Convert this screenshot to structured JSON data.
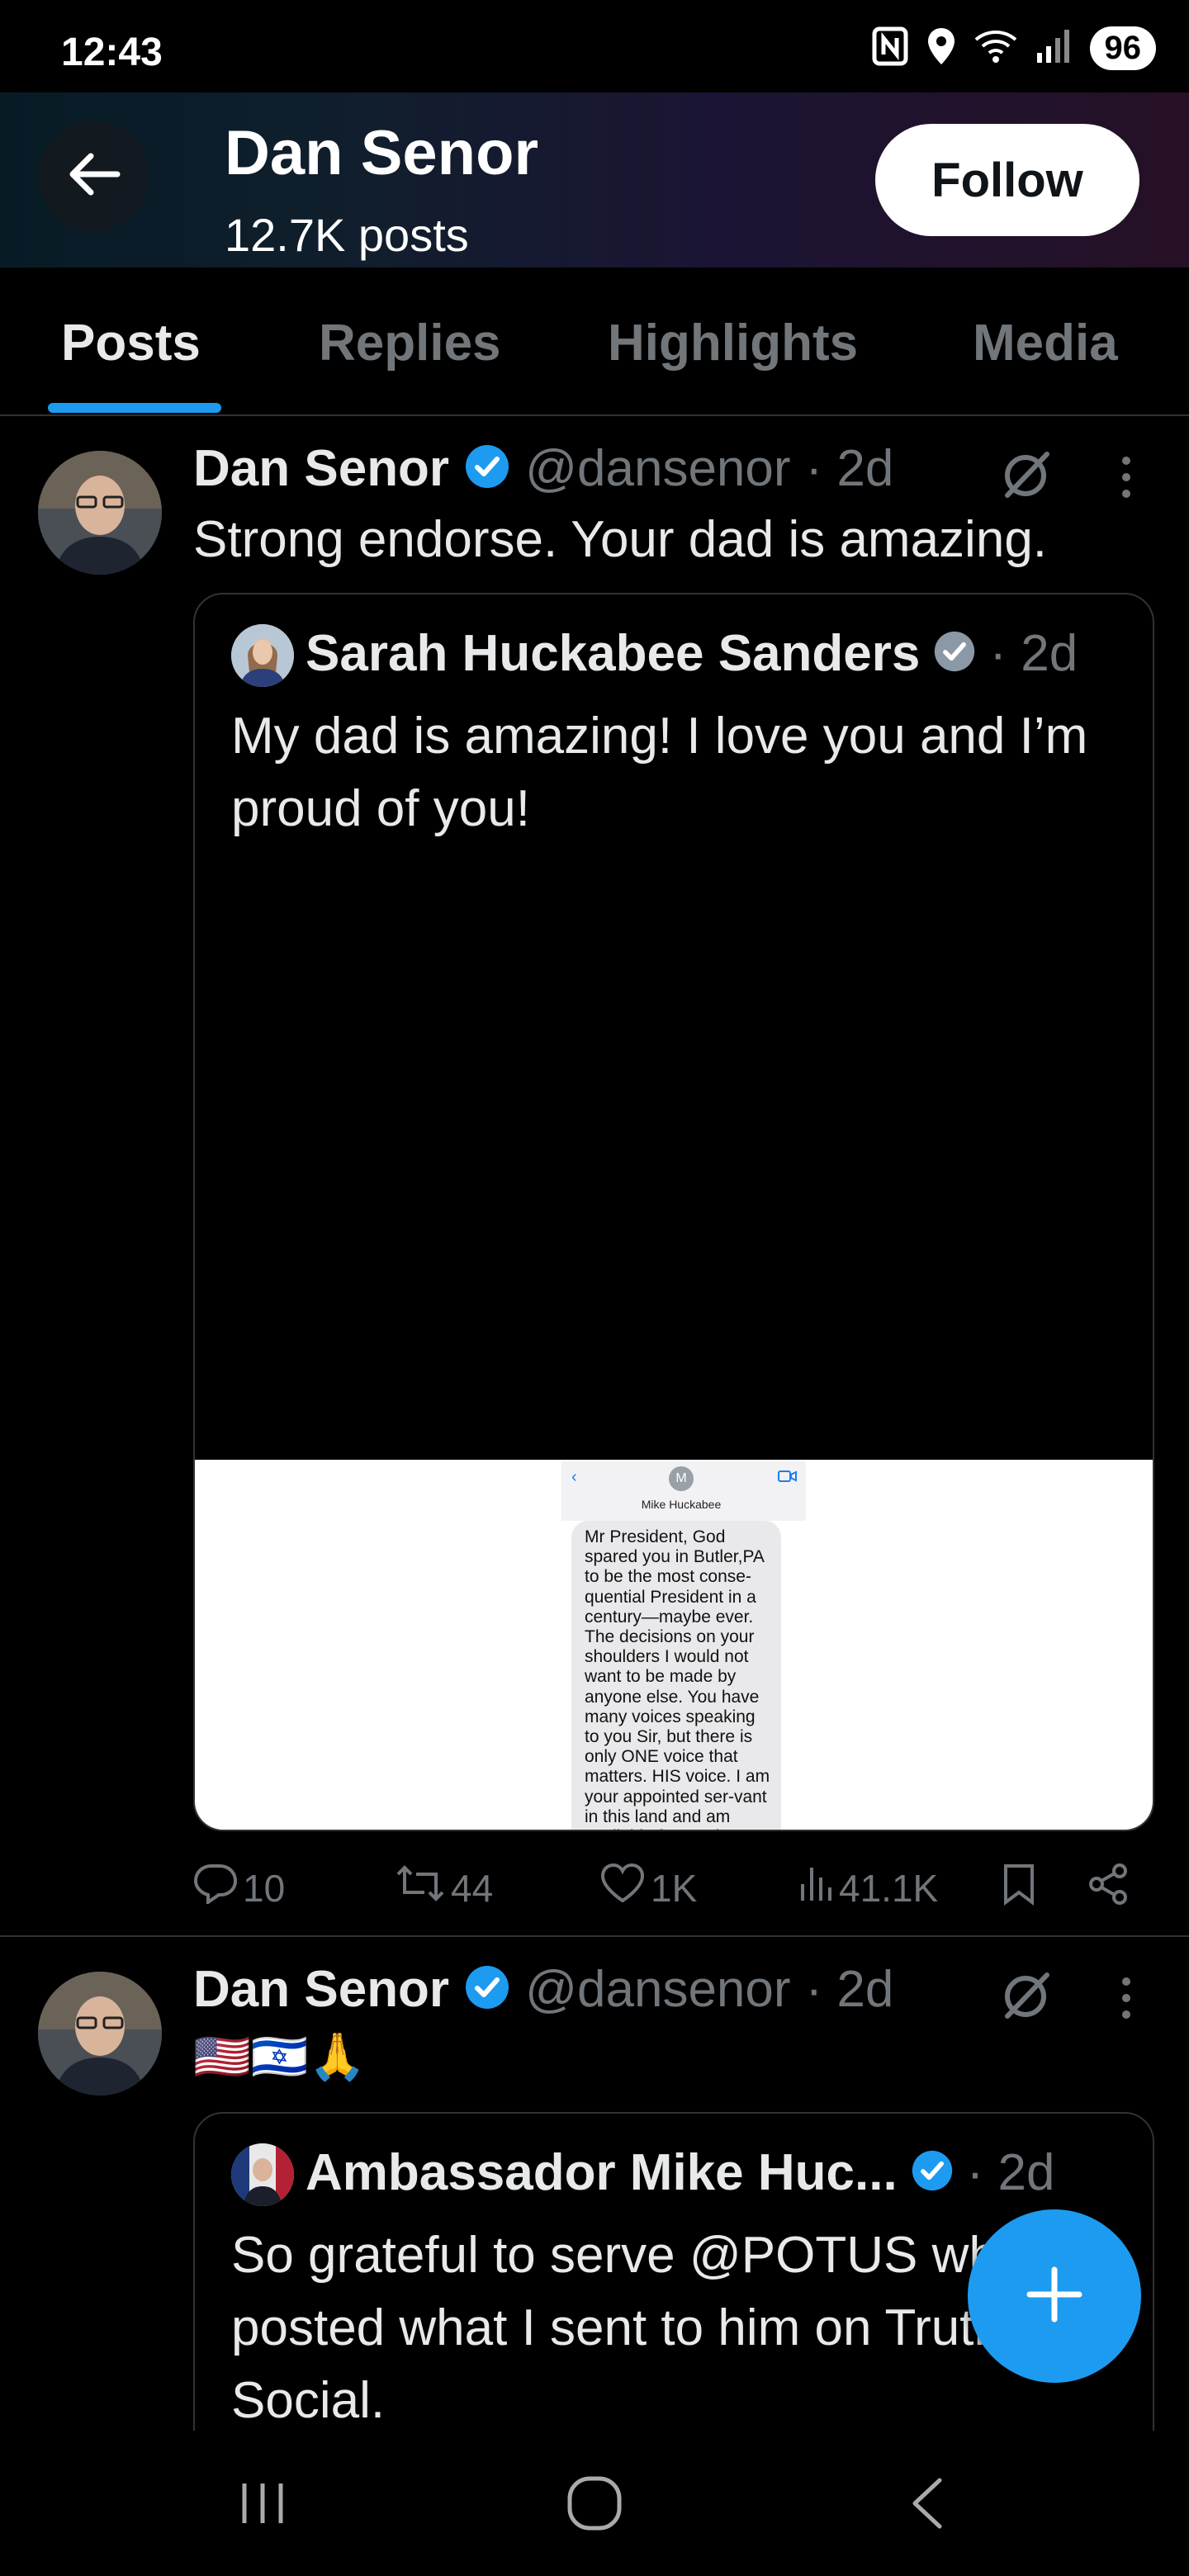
{
  "status_bar": {
    "time": "12:43",
    "battery": "96"
  },
  "header": {
    "name": "Dan Senor",
    "posts_count": "12.7K posts",
    "follow_label": "Follow"
  },
  "tabs": [
    {
      "label": "Posts",
      "active": true
    },
    {
      "label": "Replies",
      "active": false
    },
    {
      "label": "Highlights",
      "active": false
    },
    {
      "label": "Media",
      "active": false
    }
  ],
  "tweets": [
    {
      "author": "Dan Senor",
      "handle": "@dansenor",
      "time": "· 2d",
      "text": "Strong endorse. Your dad is amazing.",
      "quote": {
        "author": "Sarah Huckabee Sanders",
        "time": "· 2d",
        "text": "My dad is amazing! I love you and I’m proud of you!",
        "image": {
          "contact_name": "Mike Huckabee",
          "avatar_letter": "M",
          "message": "Mr President, God spared you in Butler,PA to be the most conse-quential President in a century—maybe ever. The decisions on your shoulders I would not want to be made by anyone else. You have many voices speaking to you Sir, but there is only ONE voice that matters. HIS voice. I am your appointed ser-vant in this land and am available for you but I do not try to get in your presence often because I trust your instincts. No President in my lifetime has been in a position like yours. Not since Truman in 1945. I don't reach out to persuade you. Only to encourage you. I believe you will hear from heaven and that voice is far more important than mine or ANYONE else's. You sent me to Israel to be your eyes, ears and voice and to make sure our flag flies above our embassy. My job is to be the last one to leave. I will not abandon this post. Our flag will NOT come down! You did not seek this moment. This moment sought YOU! It is my honor to serve you! Mike Huckabee"
        }
      },
      "actions": {
        "replies": "10",
        "reposts": "44",
        "likes": "1K",
        "views": "41.1K"
      }
    },
    {
      "author": "Dan Senor",
      "handle": "@dansenor",
      "time": "· 2d",
      "text": "🇺🇸🇮🇱🙏",
      "quote": {
        "author": "Ambassador Mike Huc...",
        "time": "· 2d",
        "text": "So grateful to serve @POTUS who posted what I sent to him on Truth Social."
      }
    }
  ],
  "colors": {
    "accent": "#1d9bf0",
    "background": "#000000",
    "muted": "#71767b",
    "border": "#2f3336"
  },
  "icons": [
    "back-arrow-icon",
    "nfc-icon",
    "location-icon",
    "wifi-icon",
    "signal-icon",
    "verified-badge-icon",
    "grok-icon",
    "more-vertical-icon",
    "reply-icon",
    "repost-icon",
    "like-icon",
    "views-icon",
    "bookmark-icon",
    "share-icon",
    "compose-plus-icon",
    "recents-nav-icon",
    "home-nav-icon",
    "back-nav-icon"
  ]
}
